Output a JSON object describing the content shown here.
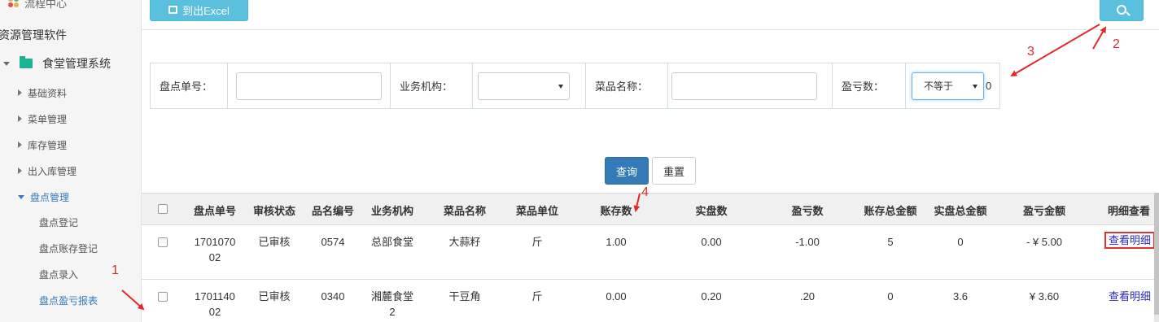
{
  "sidebar": {
    "top_item": "流程中心",
    "section": "资源管理软件",
    "system": "食堂管理系统",
    "items": [
      {
        "label": "基础资料"
      },
      {
        "label": "菜单管理"
      },
      {
        "label": "库存管理"
      },
      {
        "label": "出入库管理"
      },
      {
        "label": "盘点管理"
      }
    ],
    "sub_items": [
      {
        "label": "盘点登记"
      },
      {
        "label": "盘点账存登记"
      },
      {
        "label": "盘点录入"
      },
      {
        "label": "盘点盈亏报表"
      }
    ]
  },
  "toolbar": {
    "export_label": "到出Excel"
  },
  "filter": {
    "order_no_label": "盘点单号：",
    "org_label": "业务机构：",
    "dish_label": "菜品名称：",
    "profit_label": "盈亏数：",
    "profit_operator": "不等于",
    "profit_value": "0"
  },
  "actions": {
    "query_label": "查询",
    "reset_label": "重置"
  },
  "table": {
    "headers": [
      "盘点单号",
      "审核状态",
      "品名编号",
      "业务机构",
      "菜品名称",
      "菜品单位",
      "账存数",
      "实盘数",
      "盈亏数",
      "账存总金额",
      "实盘总金额",
      "盈亏金额",
      "明细查看"
    ],
    "rows": [
      {
        "order_no_1": "1701070",
        "order_no_2": "02",
        "status": "已审核",
        "code": "0574",
        "org_1": "总部食堂",
        "org_2": "",
        "dish": "大蒜籽",
        "unit": "斤",
        "book_qty": "1.00",
        "actual_qty": "0.00",
        "diff_qty": "-1.00",
        "book_amt": "5",
        "actual_amt": "0",
        "diff_amt": "- ¥ 5.00",
        "detail": "查看明细"
      },
      {
        "order_no_1": "1701140",
        "order_no_2": "02",
        "status": "已审核",
        "code": "0340",
        "org_1": "湘麓食堂",
        "org_2": "2",
        "dish": "干豆角",
        "unit": "斤",
        "book_qty": "0.00",
        "actual_qty": "0.20",
        "diff_qty": ".20",
        "book_amt": "0",
        "actual_amt": "3.6",
        "diff_amt": "¥ 3.60",
        "detail": "查看明细"
      }
    ]
  },
  "annotations": {
    "n1": "1",
    "n2": "2",
    "n3": "3",
    "n4": "4"
  },
  "colors": {
    "accent": "#5bc0de",
    "primary": "#337ab7",
    "annotation": "#e02a2a",
    "sidebar_active": "#337ab7"
  }
}
